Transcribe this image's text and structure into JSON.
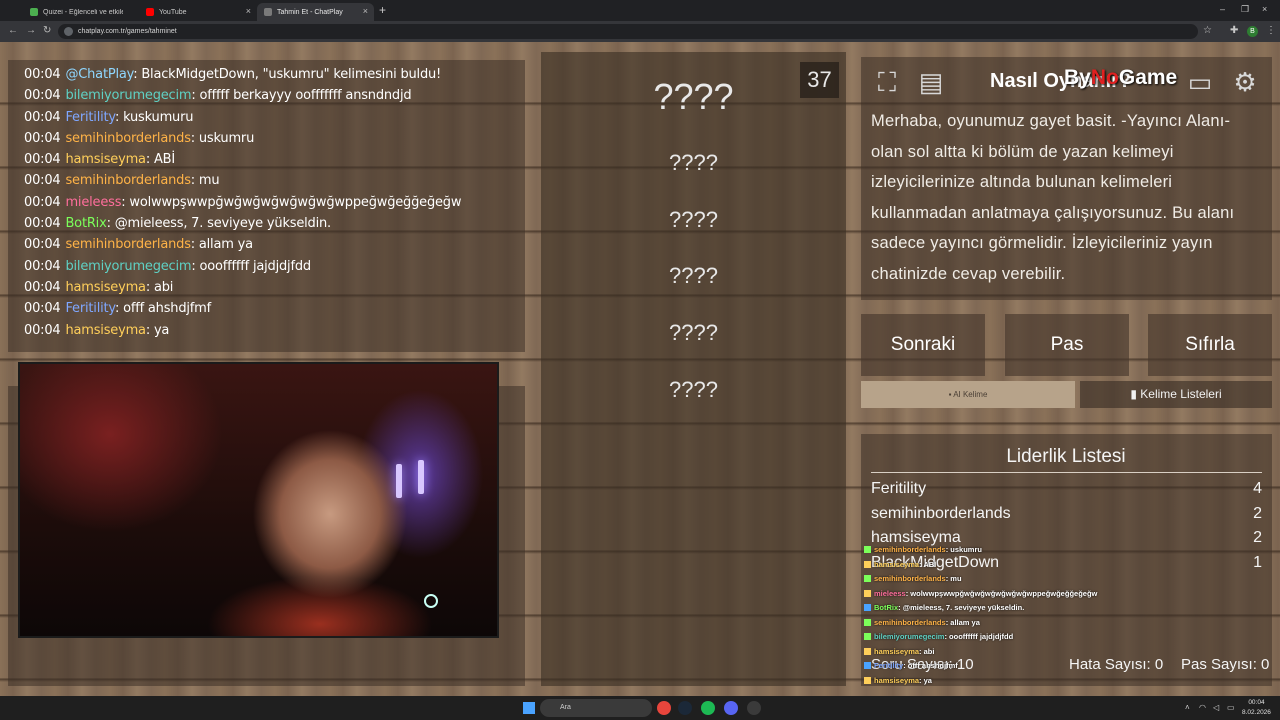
{
  "browser": {
    "tabs": [
      {
        "label": "Quizei - Eğlenceli ve etkileşimli",
        "close": "×"
      },
      {
        "label": "YouTube",
        "close": "×"
      },
      {
        "label": "Tahmin Et - ChatPlay",
        "close": "×"
      }
    ],
    "new_tab": "+",
    "url": "chatplay.com.tr/games/tahminet",
    "window_controls": [
      "–",
      "❐",
      "×"
    ],
    "profile_initial": "B"
  },
  "chat": [
    {
      "time": "00:04",
      "user": "@ChatPlay",
      "color": "#8fd7ff",
      "msg": ": BlackMidgetDown, \"uskumru\" kelimesini buldu!"
    },
    {
      "time": "00:04",
      "user": "bilemiyorumegecim",
      "color": "#5fd1c4",
      "msg": ": offfff berkayyy oofffffff ansndndjd"
    },
    {
      "time": "00:04",
      "user": "Feritility",
      "color": "#7fa7ff",
      "msg": ": kuskumuru"
    },
    {
      "time": "00:04",
      "user": "semihinborderlands",
      "color": "#ffb347",
      "msg": ": uskumru"
    },
    {
      "time": "00:04",
      "user": "hamsiseyma",
      "color": "#ffcf5a",
      "msg": ": ABİ"
    },
    {
      "time": "00:04",
      "user": "semihinborderlands",
      "color": "#ffb347",
      "msg": ": mu"
    },
    {
      "time": "00:04",
      "user": "mieleess",
      "color": "#ff6e9c",
      "msg": ": wolwwpşwwpğwğwğwğwğwğwğwppeğwğeğğeğeğw"
    },
    {
      "time": "00:04",
      "user": "BotRix",
      "color": "#7cff5a",
      "msg": ": @mieleess, 7. seviyeye yükseldin."
    },
    {
      "time": "00:04",
      "user": "semihinborderlands",
      "color": "#ffb347",
      "msg": ": allam ya"
    },
    {
      "time": "00:04",
      "user": "bilemiyorumegecim",
      "color": "#5fd1c4",
      "msg": ": oooffffff jajdjdjfdd"
    },
    {
      "time": "00:04",
      "user": "hamsiseyma",
      "color": "#ffcf5a",
      "msg": ": abi"
    },
    {
      "time": "00:04",
      "user": "Feritility",
      "color": "#7fa7ff",
      "msg": ": offf ahshdjfmf"
    },
    {
      "time": "00:04",
      "user": "hamsiseyma",
      "color": "#ffcf5a",
      "msg": ": ya"
    }
  ],
  "game": {
    "counter": "37",
    "hidden_words": [
      "????",
      "????",
      "????",
      "????",
      "????",
      "????"
    ],
    "info_title": "Nasıl Oynanır?",
    "brand_prefix": "By",
    "brand_mid": "No",
    "brand_suffix": "Game",
    "info_text": "Merhaba, oyunumuz gayet basit. -Yayıncı Alanı- olan sol altta ki bölüm de yazan kelimeyi izleyicilerinize altında bulunan kelimeleri kullanmadan anlatmaya çalışıyorsunuz. Bu alanı sadece yayıncı görmelidir. İzleyicileriniz yayın chatinizde cevap verebilir.",
    "buttons": {
      "next": "Sonraki",
      "pass": "Pas",
      "reset": "Sıfırla",
      "ai": "AI Kelime",
      "lists": "Kelime Listeleri"
    },
    "leaderboard": {
      "title": "Liderlik Listesi",
      "rows": [
        {
          "name": "Feritility",
          "score": "4"
        },
        {
          "name": "semihinborderlands",
          "score": "2"
        },
        {
          "name": "hamsiseyma",
          "score": "2"
        },
        {
          "name": "BlackMidgetDown",
          "score": "1"
        }
      ]
    },
    "stats": {
      "score": "Soru Sayısı: 10",
      "errors": "Hata Sayısı: 0",
      "passes": "Pas Sayısı: 0"
    }
  },
  "overlay_chat": [
    {
      "user": "semihinborderlands",
      "color": "#ffb347",
      "msg": ": uskumru"
    },
    {
      "user": "hamsiseyma",
      "color": "#ffcf5a",
      "msg": ": ABİ"
    },
    {
      "user": "semihinborderlands",
      "color": "#ffb347",
      "msg": ": mu"
    },
    {
      "user": "mieleess",
      "color": "#ff6e9c",
      "msg": ": wolwwpşwwpğwğwğwğwğwğwğwppeğwğeğğeğeğw"
    },
    {
      "user": "BotRix",
      "color": "#7cff5a",
      "msg": ": @mieleess, 7. seviyeye yükseldin."
    },
    {
      "user": "semihinborderlands",
      "color": "#ffb347",
      "msg": ": allam ya"
    },
    {
      "user": "bilemiyorumegecim",
      "color": "#5fd1c4",
      "msg": ": oooffffff jajdjdjfdd"
    },
    {
      "user": "hamsiseyma",
      "color": "#ffcf5a",
      "msg": ": abi"
    },
    {
      "user": "Feritility",
      "color": "#7fa7ff",
      "msg": ": offf ahshdjfmf"
    },
    {
      "user": "hamsiseyma",
      "color": "#ffcf5a",
      "msg": ": ya"
    }
  ],
  "taskbar": {
    "search_placeholder": "Ara",
    "clock_time": "00:04",
    "clock_date": "8.02.2026"
  }
}
